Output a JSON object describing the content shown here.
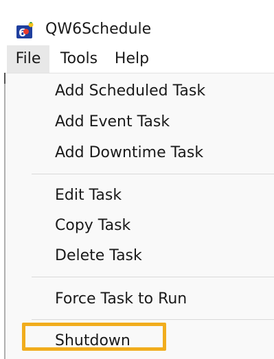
{
  "window": {
    "title": "QW6Schedule",
    "icon": "qw6-app-icon"
  },
  "menubar": {
    "items": [
      {
        "label": "File",
        "active": true
      },
      {
        "label": "Tools",
        "active": false
      },
      {
        "label": "Help",
        "active": false
      }
    ]
  },
  "file_menu": {
    "groups": [
      [
        "Add Scheduled Task",
        "Add Event Task",
        "Add Downtime Task"
      ],
      [
        "Edit Task",
        "Copy Task",
        "Delete Task"
      ],
      [
        "Force Task to Run"
      ],
      [
        "Shutdown"
      ]
    ],
    "highlighted_item": "Shutdown"
  },
  "colors": {
    "highlight_border": "#f1ad1d",
    "menu_background": "#f9f9f9",
    "active_menubar_item": "#e8e8e8"
  }
}
